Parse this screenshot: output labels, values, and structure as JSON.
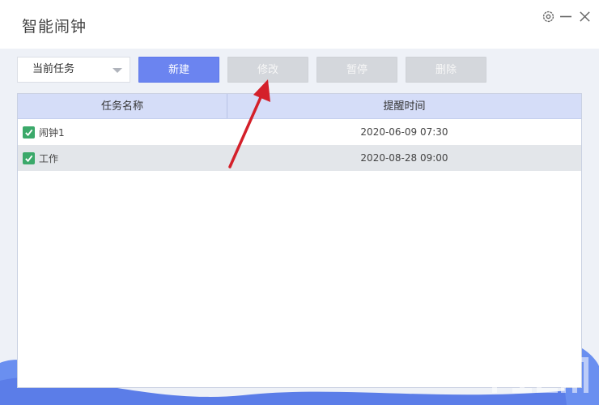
{
  "window": {
    "title": "智能闹钟"
  },
  "toolbar": {
    "task_filter": "当前任务",
    "new_label": "新建",
    "edit_label": "修改",
    "pause_label": "暂停",
    "delete_label": "删除"
  },
  "table": {
    "columns": [
      "任务名称",
      "提醒时间"
    ],
    "rows": [
      {
        "name": "闹钟1",
        "time": "2020-06-09 07:30",
        "checked": true
      },
      {
        "name": "工作",
        "time": "2020-08-28 09:00",
        "checked": true
      }
    ]
  },
  "colors": {
    "primary": "#6b84f0",
    "disabled": "#d4d7dc",
    "header": "#d5ddf8",
    "check": "#3ba96a",
    "annotation_arrow": "#d4202a"
  },
  "icons": [
    "settings-icon",
    "minimize-icon",
    "close-icon",
    "chevron-down-icon",
    "check-icon",
    "annotation-arrow"
  ]
}
